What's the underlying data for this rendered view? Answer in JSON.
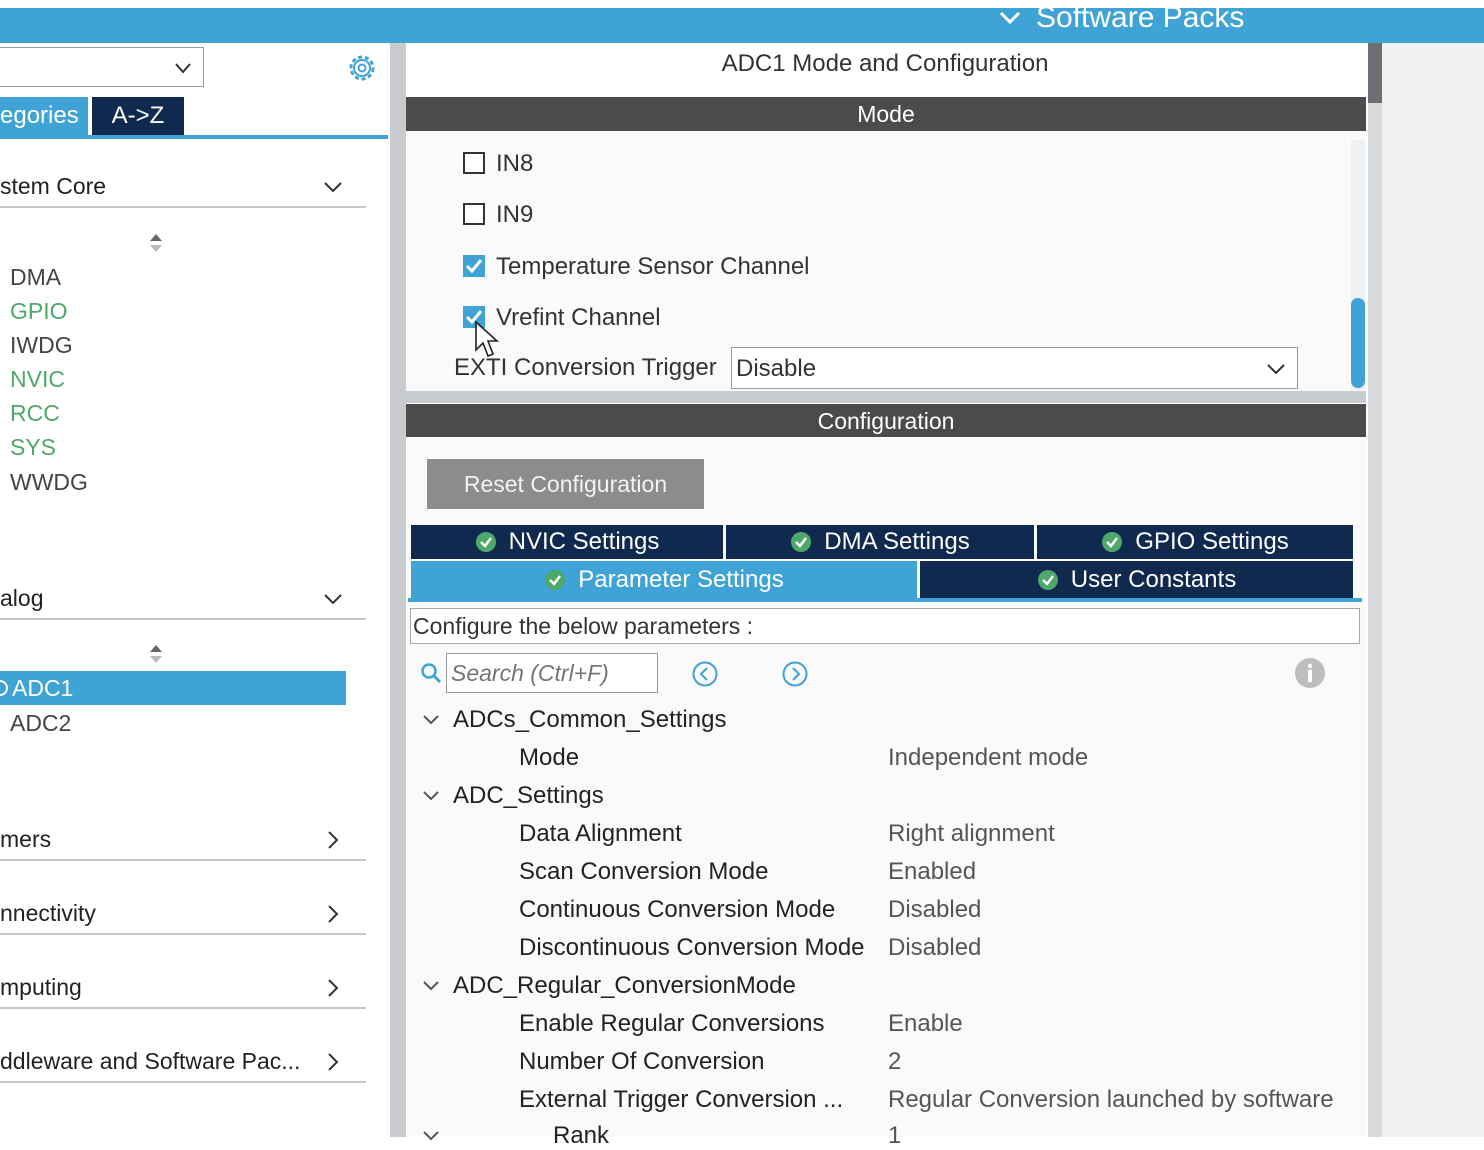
{
  "header": {
    "software_packs": "Software Packs"
  },
  "left": {
    "tabs": {
      "categories": "egories",
      "az": "A->Z"
    },
    "sections": [
      {
        "label": "stem Core",
        "expanded": true,
        "items": [
          {
            "label": "DMA",
            "color": "#444444"
          },
          {
            "label": "GPIO",
            "color": "#4ea86a"
          },
          {
            "label": "IWDG",
            "color": "#444444"
          },
          {
            "label": "NVIC",
            "color": "#4ea86a"
          },
          {
            "label": "RCC",
            "color": "#4ea86a"
          },
          {
            "label": "SYS",
            "color": "#4ea86a"
          },
          {
            "label": "WWDG",
            "color": "#444444"
          }
        ]
      },
      {
        "label": "alog",
        "expanded": true,
        "items": [
          {
            "label": "ADC1",
            "selected": true
          },
          {
            "label": "ADC2"
          }
        ]
      },
      {
        "label": "mers",
        "expanded": false
      },
      {
        "label": "nnectivity",
        "expanded": false
      },
      {
        "label": "mputing",
        "expanded": false
      },
      {
        "label": "ddleware and Software Pac...",
        "expanded": false
      }
    ]
  },
  "right": {
    "title": "ADC1 Mode and Configuration",
    "mode_bar": "Mode",
    "mode_options": [
      {
        "label": "IN8",
        "checked": false
      },
      {
        "label": "IN9",
        "checked": false
      },
      {
        "label": "Temperature Sensor Channel",
        "checked": true
      },
      {
        "label": "Vrefint Channel",
        "checked": true
      }
    ],
    "exti_label": "EXTI Conversion Trigger",
    "exti_value": "Disable",
    "config_bar": "Configuration",
    "reset_button": "Reset Configuration",
    "tabs": {
      "nvic": "NVIC Settings",
      "dma": "DMA Settings",
      "gpio": "GPIO Settings",
      "parameter": "Parameter Settings",
      "user_constants": "User Constants"
    },
    "note": "Configure the below parameters :",
    "search_placeholder": "Search (Ctrl+F)",
    "groups": [
      {
        "label": "ADCs_Common_Settings",
        "params": [
          {
            "name": "Mode",
            "value": "Independent mode"
          }
        ]
      },
      {
        "label": "ADC_Settings",
        "params": [
          {
            "name": "Data Alignment",
            "value": "Right alignment"
          },
          {
            "name": "Scan Conversion Mode",
            "value": "Enabled"
          },
          {
            "name": "Continuous Conversion Mode",
            "value": "Disabled"
          },
          {
            "name": "Discontinuous Conversion Mode",
            "value": "Disabled"
          }
        ]
      },
      {
        "label": "ADC_Regular_ConversionMode",
        "params": [
          {
            "name": "Enable Regular Conversions",
            "value": "Enable"
          },
          {
            "name": "Number Of Conversion",
            "value": "2"
          },
          {
            "name": "External Trigger Conversion ...",
            "value": "Regular Conversion launched by software"
          }
        ]
      },
      {
        "label": "Rank",
        "value": "1"
      }
    ]
  },
  "colors": {
    "accent": "#3fa3d6",
    "dark_tab": "#10294f",
    "bar": "#4b4b4b",
    "green": "#4ea86a"
  }
}
